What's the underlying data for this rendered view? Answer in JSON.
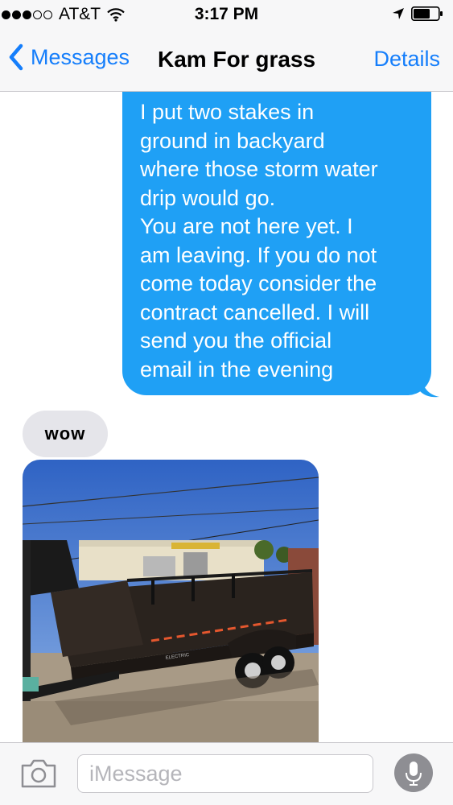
{
  "status_bar": {
    "carrier": "AT&T",
    "time": "3:17 PM",
    "signal_bars_filled": 3,
    "signal_bars_total": 5
  },
  "nav": {
    "back_label": "Messages",
    "title": "Kam For grass",
    "details_label": "Details"
  },
  "messages": [
    {
      "direction": "outgoing",
      "type": "text",
      "text": "I put two stakes in\nground in backyard\nwhere those storm water\ndrip would go.\nYou are not here yet. I\nam leaving. If you do not\ncome today consider the\ncontract cancelled. I will\nsend you the official\nemail in the evening"
    },
    {
      "direction": "incoming",
      "type": "text",
      "text": "wow"
    },
    {
      "direction": "incoming",
      "type": "image",
      "photo_text": "ELECTRIC"
    }
  ],
  "input": {
    "placeholder": "iMessage"
  },
  "colors": {
    "accent": "#157efb",
    "outgoing_bubble": "#1fa0f5",
    "incoming_bubble": "#e5e5ea"
  },
  "icons": {
    "back": "chevron-left-icon",
    "camera": "camera-icon",
    "mic": "microphone-icon",
    "wifi": "wifi-icon",
    "location": "location-arrow-icon",
    "battery": "battery-icon"
  }
}
